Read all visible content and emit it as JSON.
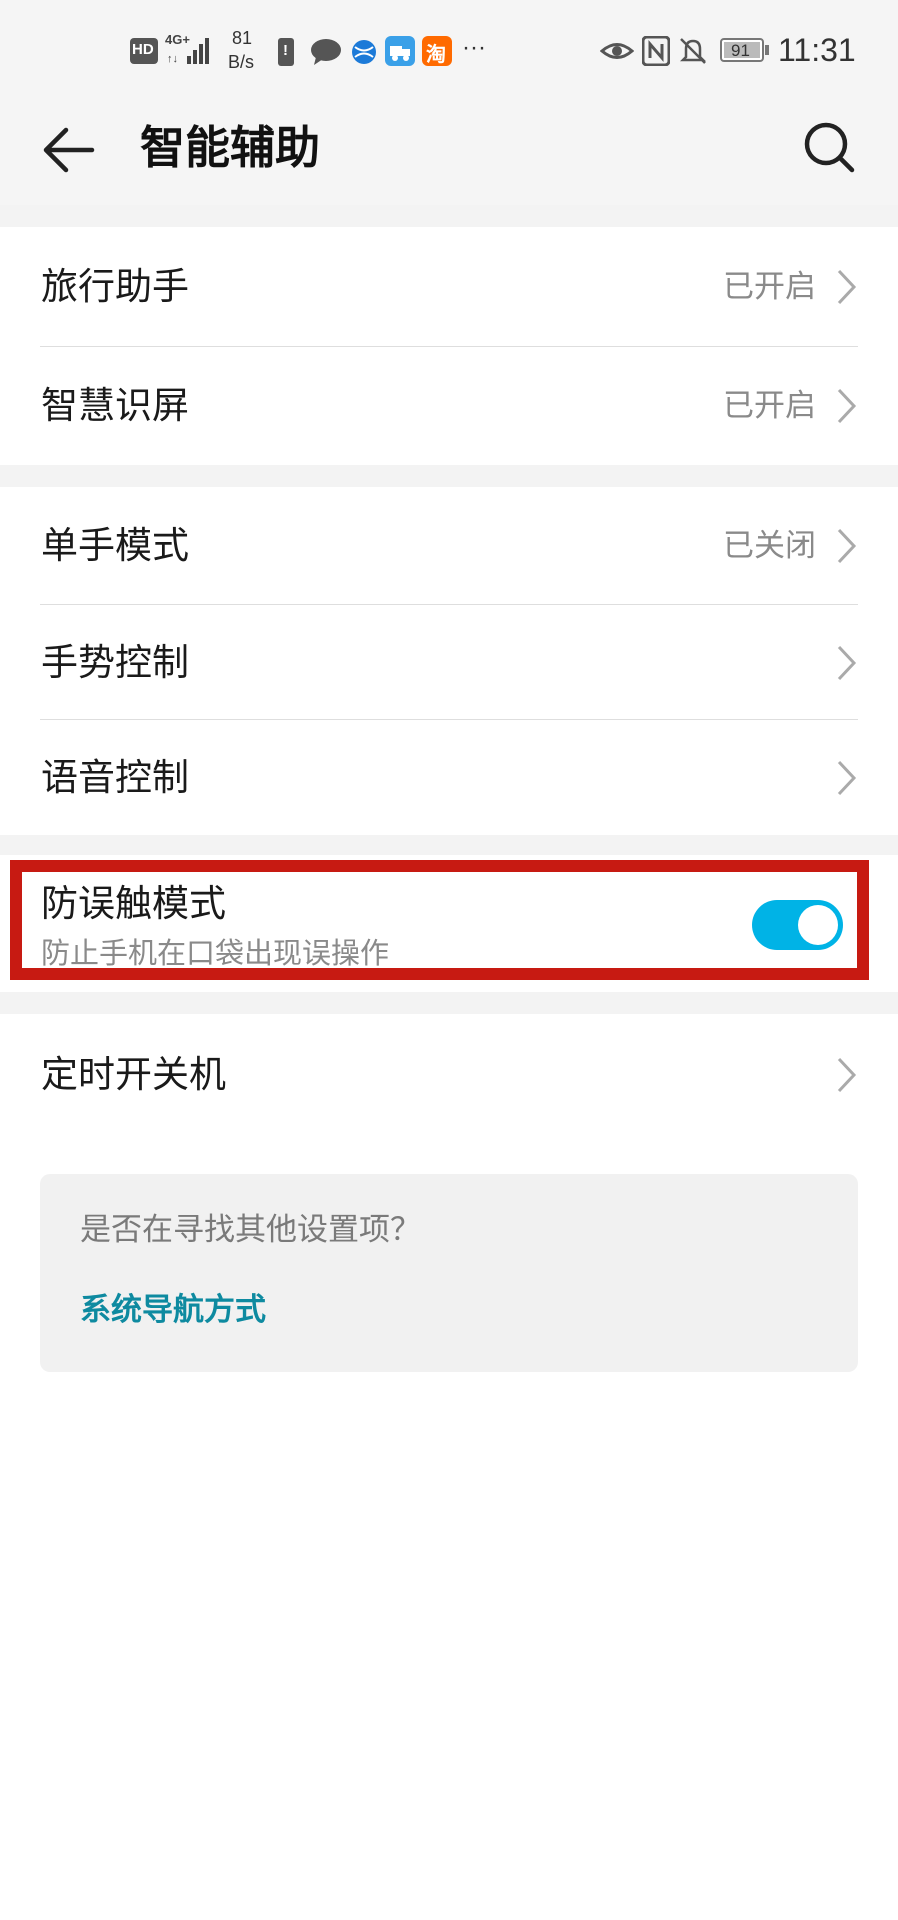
{
  "status_bar": {
    "hd_label": "HD",
    "network_label": "4G+",
    "speed_value": "81",
    "speed_unit": "B/s",
    "more_label": "···",
    "battery_level": "91",
    "time": "11:31",
    "icons": [
      "hd-icon",
      "signal-icon",
      "battery-alert-icon",
      "message-icon",
      "browser-icon",
      "delivery-icon",
      "taobao-icon",
      "eye-icon",
      "nfc-icon",
      "mute-bell-icon",
      "battery-icon"
    ]
  },
  "header": {
    "title": "智能辅助",
    "back_icon": "back-arrow-icon",
    "search_icon": "search-icon"
  },
  "sections": {
    "travel": {
      "label": "旅行助手",
      "status": "已开启"
    },
    "smart_screen": {
      "label": "智慧识屏",
      "status": "已开启"
    },
    "one_hand": {
      "label": "单手模式",
      "status": "已关闭"
    },
    "gesture": {
      "label": "手势控制"
    },
    "voice": {
      "label": "语音控制"
    },
    "pocket_mode": {
      "label": "防误触模式",
      "subtitle": "防止手机在口袋出现误操作",
      "enabled": true
    },
    "scheduled_power": {
      "label": "定时开关机"
    }
  },
  "suggestion_card": {
    "question": "是否在寻找其他设置项？",
    "link": "系统导航方式"
  },
  "colors": {
    "accent": "#00b3e6",
    "link": "#0e8aa0",
    "highlight": "#c71a12"
  }
}
